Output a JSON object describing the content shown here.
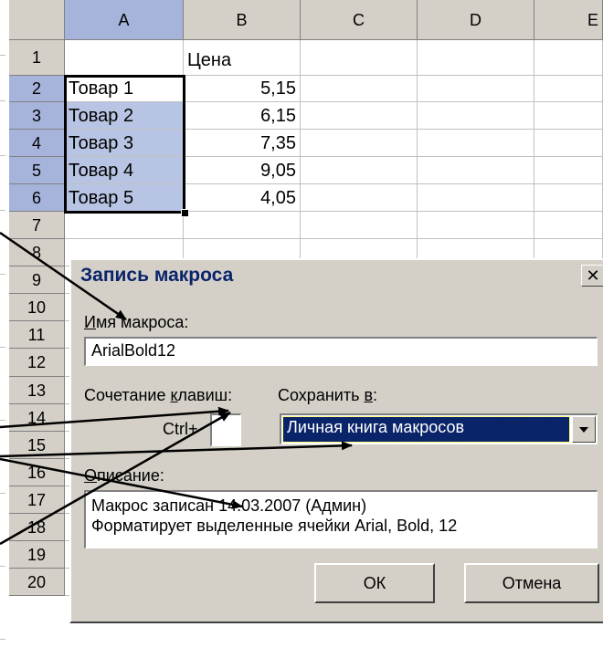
{
  "sheet": {
    "columns": [
      "A",
      "B",
      "C",
      "D",
      "E"
    ],
    "rows": [
      "1",
      "2",
      "3",
      "4",
      "5",
      "6",
      "7",
      "8",
      "9",
      "10",
      "11",
      "12",
      "13",
      "14",
      "15",
      "16",
      "17",
      "18",
      "19",
      "20"
    ],
    "b1": "Цена",
    "items": [
      {
        "name": "Товар 1",
        "price": "5,15"
      },
      {
        "name": "Товар 2",
        "price": "6,15"
      },
      {
        "name": "Товар 3",
        "price": "7,35"
      },
      {
        "name": "Товар 4",
        "price": "9,05"
      },
      {
        "name": "Товар 5",
        "price": "4,05"
      }
    ]
  },
  "dialog": {
    "title": "Запись макроса",
    "close_glyph": "✕",
    "macro_name_label_hotkey": "И",
    "macro_name_label_rest": "мя макроса:",
    "macro_name_value": "ArialBold12",
    "shortcut_label_prefix": "Сочетание ",
    "shortcut_label_hotkey": "к",
    "shortcut_label_rest": "лавиш:",
    "ctrl_label": "Ctrl+",
    "shortcut_value": "",
    "save_in_label_prefix": "Сохранить ",
    "save_in_label_hotkey": "в",
    "save_in_label_rest": ":",
    "save_in_value": "Личная книга макросов",
    "description_label_hotkey": "О",
    "description_label_rest": "писание:",
    "description_line1": "Макрос записан 14.03.2007 (Админ)",
    "description_line2": "Форматирует выделенные ячейки Arial, Bold, 12",
    "ok_label": "ОК",
    "cancel_label": "Отмена"
  },
  "colors": {
    "selection_fill": "#b8c4e4",
    "header_selected": "#a6b4dc",
    "dialog_face": "#d4d0c8",
    "title_text": "#0a246a",
    "combo_highlight": "#0a246a"
  }
}
